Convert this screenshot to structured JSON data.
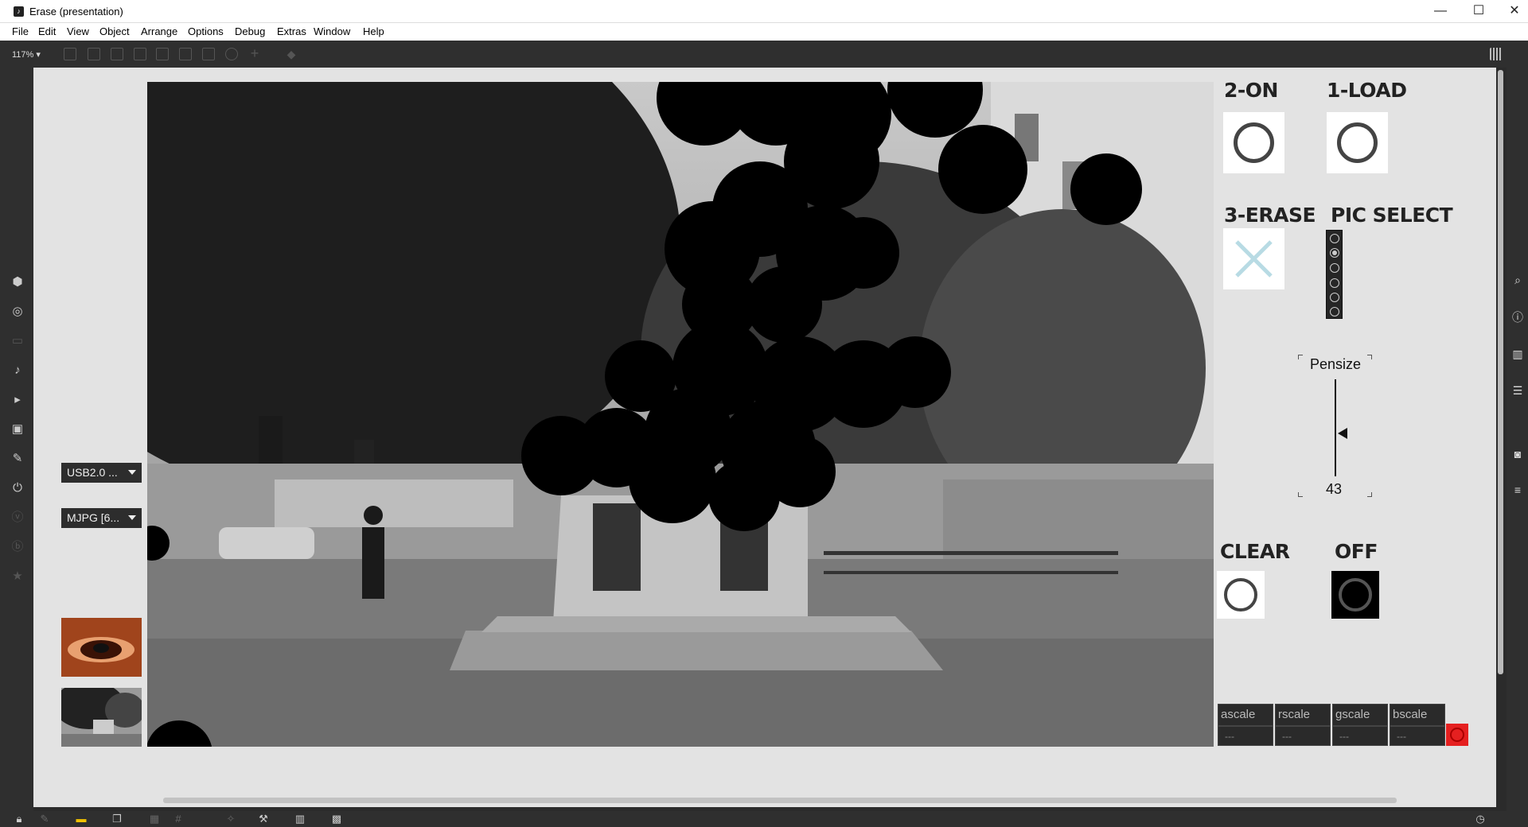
{
  "window": {
    "title": "Erase (presentation)",
    "controls": [
      "—",
      "☐",
      "✕"
    ]
  },
  "menu": [
    "File",
    "Edit",
    "View",
    "Object",
    "Arrange",
    "Options",
    "Debug",
    "Extras",
    "Window",
    "Help"
  ],
  "toolbar": {
    "zoom": "117% ▾"
  },
  "left_panel": {
    "device_dropdown": "USB2.0 ...",
    "format_dropdown": "MJPG [6..."
  },
  "controls": {
    "on_label": "2-ON",
    "load_label": "1-LOAD",
    "erase_label": "3-ERASE",
    "pic_select_label": "PIC SELECT",
    "pic_select_selected": 1,
    "pic_select_count": 6,
    "slider_label": "Pensize",
    "slider_value": "43",
    "slider_level": 0.43,
    "clear_label": "CLEAR",
    "off_label": "OFF"
  },
  "scales": [
    {
      "name": "ascale",
      "value": "---"
    },
    {
      "name": "rscale",
      "value": "---"
    },
    {
      "name": "gscale",
      "value": "---"
    },
    {
      "name": "bscale",
      "value": "---"
    }
  ],
  "icons": {
    "left": [
      "cube-icon",
      "target-icon",
      "sequence-icon",
      "note-icon",
      "play-step-icon",
      "image-icon",
      "paperclip-icon",
      "plug-icon",
      "v-icon",
      "b-icon",
      "star-icon"
    ],
    "right": [
      "search-icon",
      "info-icon",
      "columns-icon",
      "list-icon",
      "camera-icon",
      "mixer-icon"
    ],
    "bottom": [
      "lock-icon",
      "edit-icon",
      "comment-icon",
      "windows-icon",
      "patch-icon",
      "grid-icon",
      "wand-icon",
      "wrench-icon",
      "piano-icon",
      "keyboard-icon",
      "clock-icon"
    ]
  }
}
